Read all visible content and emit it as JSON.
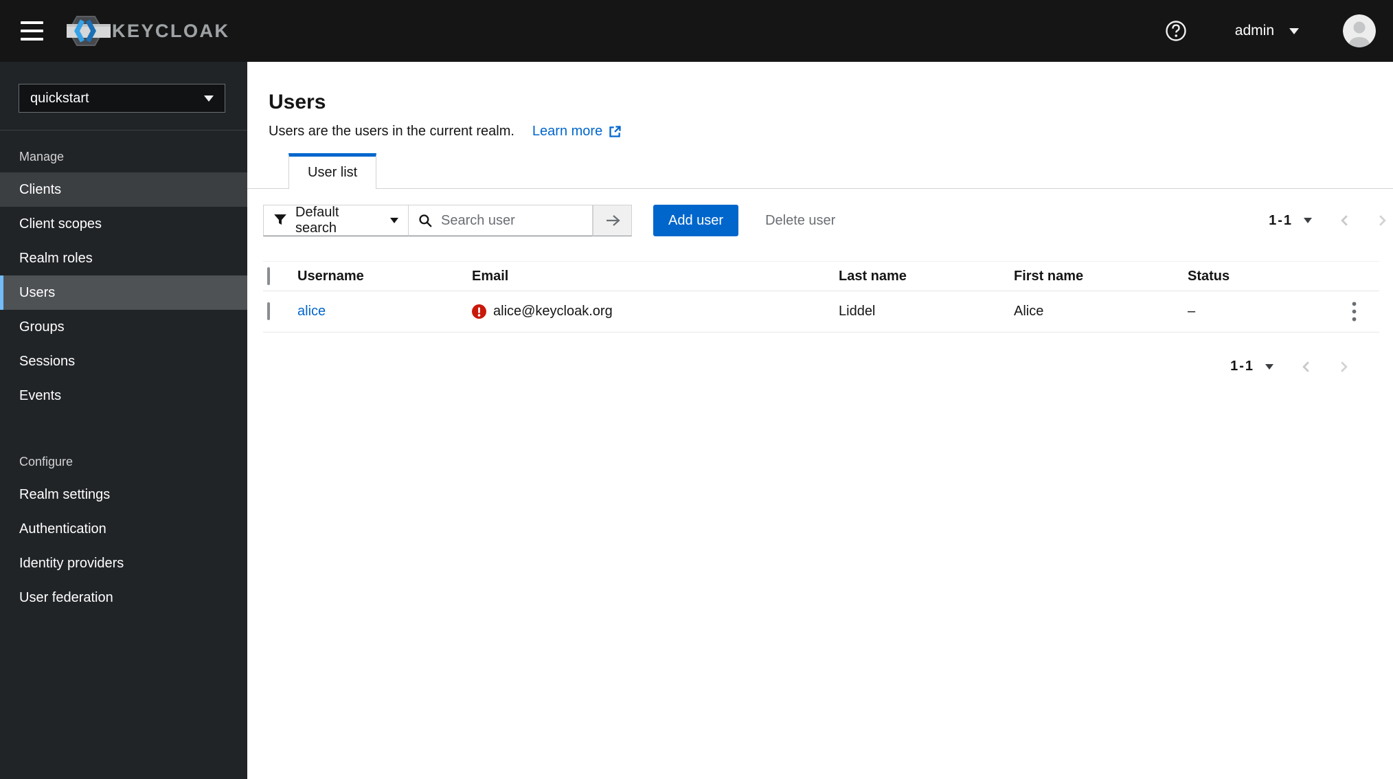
{
  "colors": {
    "accent": "#0066cc",
    "danger": "#c9190b",
    "header_bg": "#151515",
    "sidebar_bg": "#212427",
    "nav_current_bg": "#4f5255",
    "nav_current_border": "#73bcf7",
    "link_blue": "#0066cc"
  },
  "header": {
    "brand": "KEYCLOAK",
    "user": "admin"
  },
  "sidebar": {
    "realm": "quickstart",
    "sections": [
      {
        "label": "Manage",
        "items": [
          "Clients",
          "Client scopes",
          "Realm roles",
          "Users",
          "Groups",
          "Sessions",
          "Events"
        ]
      },
      {
        "label": "Configure",
        "items": [
          "Realm settings",
          "Authentication",
          "Identity providers",
          "User federation"
        ]
      }
    ],
    "selected_item": "Users"
  },
  "page": {
    "title": "Users",
    "description": "Users are the users in the current realm.",
    "learn_more_label": "Learn more",
    "tab_label": "User list"
  },
  "toolbar": {
    "filter_label": "Default search",
    "search_placeholder": "Search user",
    "add_user_label": "Add user",
    "delete_user_label": "Delete user",
    "pagination_range": "1-1"
  },
  "table": {
    "headers": [
      "Username",
      "Email",
      "Last name",
      "First name",
      "Status"
    ],
    "row": {
      "username": "alice",
      "email": "alice@keycloak.org",
      "email_invalid": true,
      "last_name": "Liddel",
      "first_name": "Alice",
      "status": "–"
    }
  },
  "bottom_pagination_range": "1-1"
}
